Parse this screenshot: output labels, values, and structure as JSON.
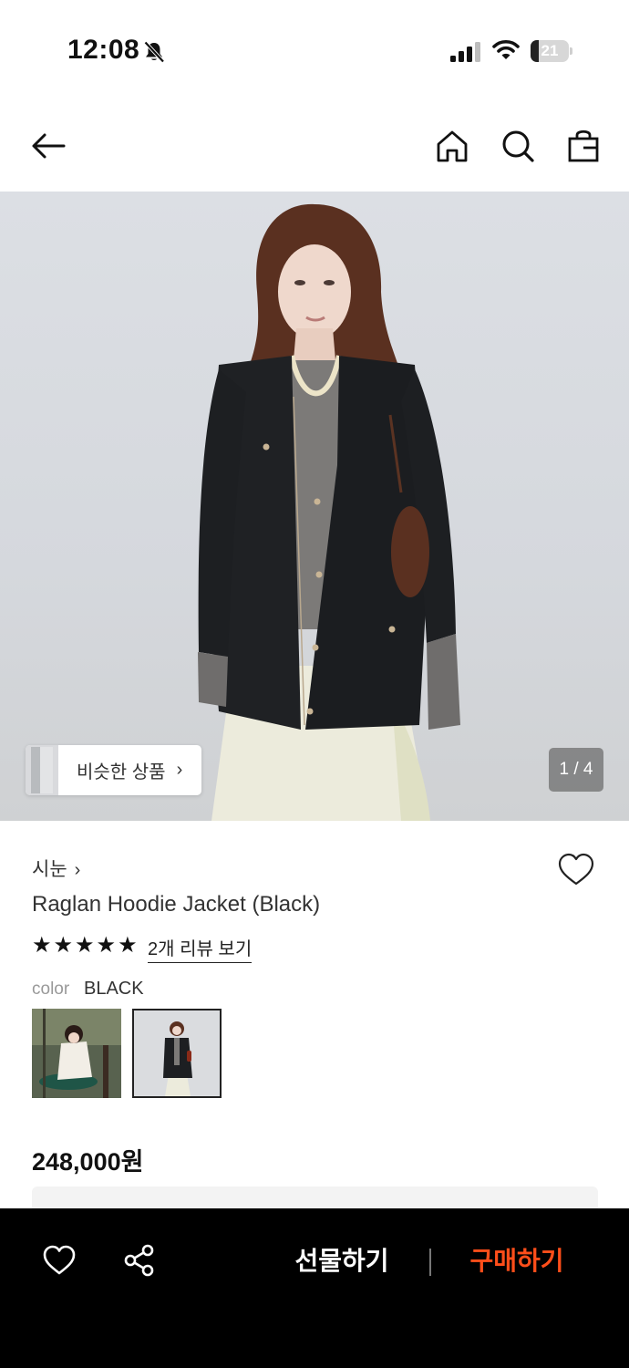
{
  "status_bar": {
    "time": "12:08",
    "battery_level": "21",
    "battery_fraction": 0.21,
    "icons": [
      "bell-slash-icon",
      "cellular-signal-icon",
      "wifi-icon",
      "battery-icon"
    ]
  },
  "nav": {
    "icons": [
      "back-arrow-icon",
      "home-icon",
      "search-icon",
      "shopping-bag-icon"
    ]
  },
  "hero": {
    "similar_products_label": "비슷한 상품",
    "page_counter": "1 / 4"
  },
  "product": {
    "brand": "시눈",
    "name": "Raglan Hoodie Jacket (Black)",
    "rating_stars": 5,
    "review_link": "2개 리뷰 보기",
    "color_label": "color",
    "color_value": "BLACK",
    "price": "248,000원"
  },
  "bottom_bar": {
    "gift_label": "선물하기",
    "buy_label": "구매하기",
    "buy_color": "#ff4e1a"
  }
}
